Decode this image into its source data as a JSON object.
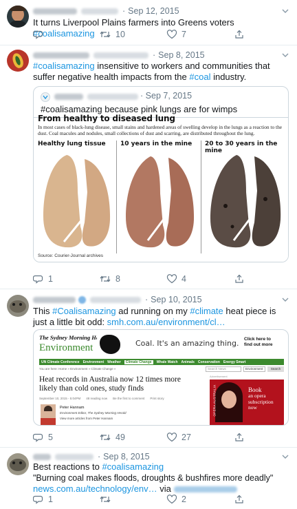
{
  "tweets": [
    {
      "date": "Sep 12, 2015",
      "text_plain": "It turns Liverpool Plains farmers into Greens voters ",
      "hashtag": "#coalisamazing",
      "replies": "",
      "retweets": "10",
      "likes": "7"
    },
    {
      "date": "Sep 8, 2015",
      "hashtag": "#coalisamazing",
      "text_1": " insensitive to workers and communities that suffer negative health impacts from the ",
      "hashtag_2": "#coal",
      "text_2": " industry.",
      "quote": {
        "date": "Sep 7, 2015",
        "text": "#coalisamazing because pink lungs are for wimps",
        "infographic": {
          "headline": "From healthy to diseased lung",
          "intro": "In most cases of black-lung disease, small stains and hardened areas of swelling develop in the lungs as a reaction to the dust. Coal macules and nodules, small collections of dust and scarring, are distributed throughout the lung.",
          "panels": [
            "Healthy lung tissue",
            "10 years in the mine",
            "20 to 30 years in the mine"
          ],
          "source": "Source: Courier-Journal archives"
        }
      },
      "replies": "1",
      "retweets": "8",
      "likes": "4"
    },
    {
      "date": "Sep 10, 2015",
      "text_1": "This ",
      "hashtag": "#Coalisamazing",
      "text_2": " ad running on my ",
      "hashtag_2": "#climate",
      "text_3": " heat piece is just a little bit odd: ",
      "url": "smh.com.au/environment/cl…",
      "article": {
        "masthead": "The Sydney Morning Herald",
        "section": "Environment",
        "ad_text": "Coal. It's an amazing thing.",
        "ad_cta": "Click here to find out more",
        "nav": [
          "UN Climate Conference",
          "Environment",
          "Weather",
          "Climate Change",
          "Whale Watch",
          "Animals",
          "Conservation",
          "Energy Smart"
        ],
        "breadcrumb": "You are here: Home » Environment » Climate Change »",
        "search": "Search News",
        "search_scope": "Environment",
        "search_btn": "Search",
        "headline": "Heat records in Australia now 12 times more likely than cold ones, study finds",
        "meta": "September 10, 2015 - 5:04PM",
        "meta_reading": "48 reading now",
        "meta_first": "Be the first to comment",
        "meta_print": "Print story",
        "author_name": "Peter Hannam",
        "author_role": "Environment Editor, The Sydney Morning Herald",
        "author_more": "View more articles from Peter Hannam",
        "side_label": "Advertisement",
        "opera_book": "Book",
        "opera_line": "an opera subscription now",
        "opera_brand": "OPERA AUSTRALIA"
      },
      "replies": "5",
      "retweets": "49",
      "likes": "27"
    },
    {
      "date": "Sep 8, 2015",
      "text_1": "Best reactions to ",
      "hashtag": "#coalisamazing",
      "line_2": "\"Burning coal makes floods, droughts & bushfires more deadly\"",
      "url": "news.com.au/technology/env…",
      "via": " via ",
      "replies": "1",
      "retweets": "",
      "likes": "2"
    }
  ],
  "icons": {
    "reply": "reply-icon",
    "retweet": "retweet-icon",
    "like": "heart-icon",
    "share": "share-icon",
    "caret": "chevron-down-icon"
  },
  "colors": {
    "link": "#1b95e0",
    "muted": "#657786",
    "border": "#e6ecf0",
    "smh_green": "#3c8a2e"
  }
}
